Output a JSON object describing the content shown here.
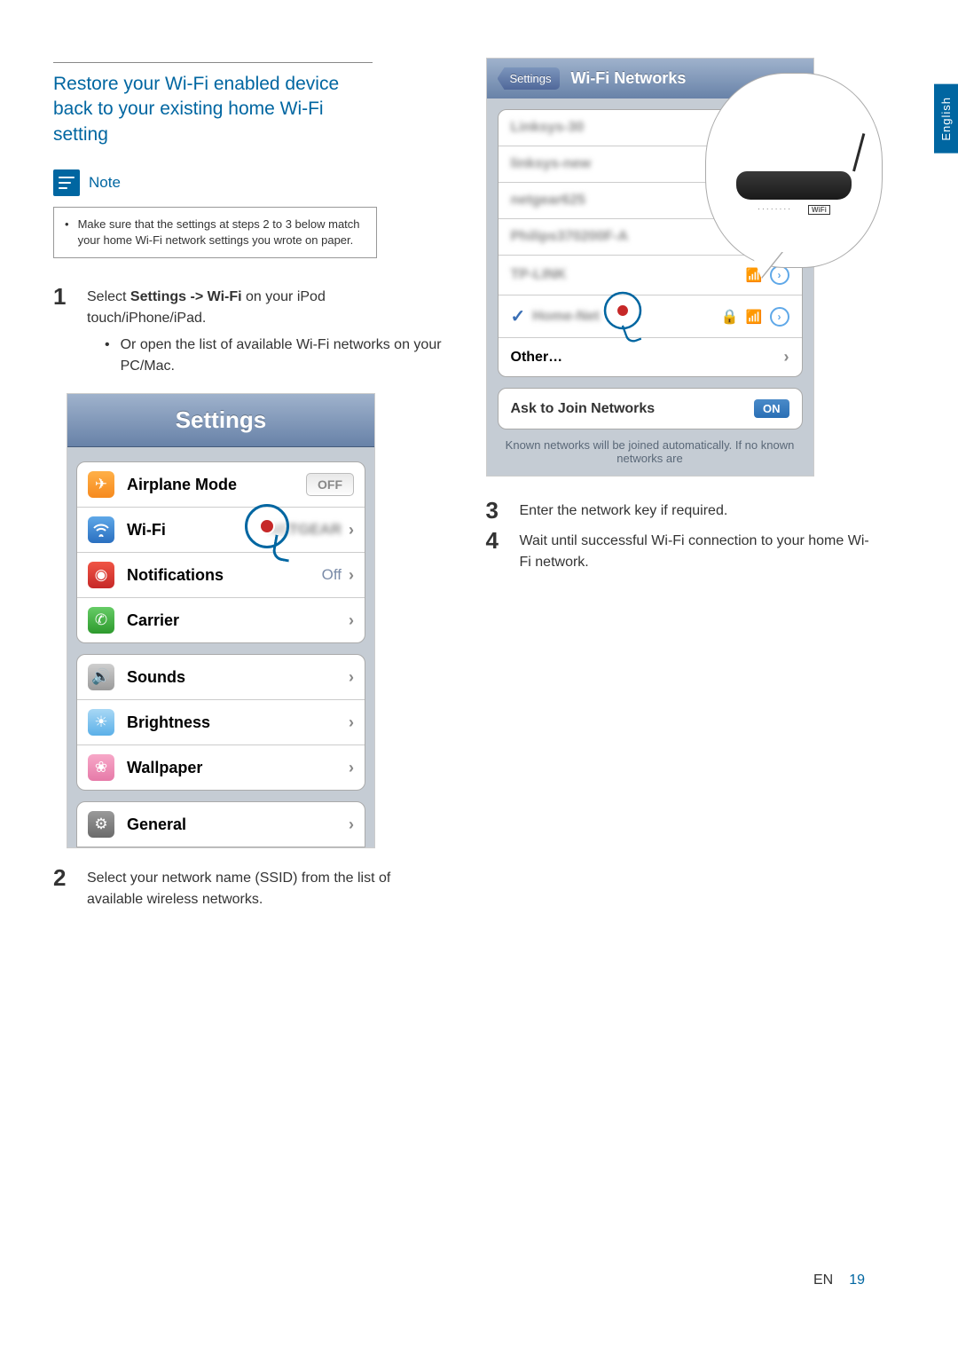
{
  "langTab": "English",
  "sectionTitle": "Restore your Wi-Fi enabled device back to your existing home Wi-Fi setting",
  "noteLabel": "Note",
  "noteText": "Make sure that the settings at steps 2 to 3 below match your home Wi-Fi network settings you wrote on paper.",
  "step1": {
    "num": "1",
    "text_a": "Select ",
    "text_b": "Settings -> Wi-Fi",
    "text_c": " on your iPod touch/iPhone/iPad."
  },
  "step1_sub": "Or open the list of available Wi-Fi networks on your PC/Mac.",
  "step2": {
    "num": "2",
    "text": "Select your network name (SSID) from the list of available wireless networks."
  },
  "step3": {
    "num": "3",
    "text": "Enter the network key if required."
  },
  "step4": {
    "num": "4",
    "text": "Wait until successful Wi-Fi connection to your home Wi-Fi network."
  },
  "settings": {
    "header": "Settings",
    "rows": {
      "airplane": "Airplane Mode",
      "airplane_val": "OFF",
      "wifi": "Wi-Fi",
      "notifications": "Notifications",
      "notifications_val": "Off",
      "carrier": "Carrier",
      "sounds": "Sounds",
      "brightness": "Brightness",
      "wallpaper": "Wallpaper",
      "general": "General"
    }
  },
  "wifi": {
    "back": "Settings",
    "title": "Wi-Fi Networks",
    "blur1": "Linksys-30",
    "blur2": "linksys-new",
    "blur3": "netgear625",
    "blur4": "Philips370200F-A",
    "blur5": "TP-LINK",
    "blur6": "Home-Net",
    "other": "Other…",
    "askJoin": "Ask to Join Networks",
    "on": "ON",
    "known": "Known networks will be joined automatically.  If no known networks are"
  },
  "footer": {
    "lang": "EN",
    "page": "19"
  }
}
